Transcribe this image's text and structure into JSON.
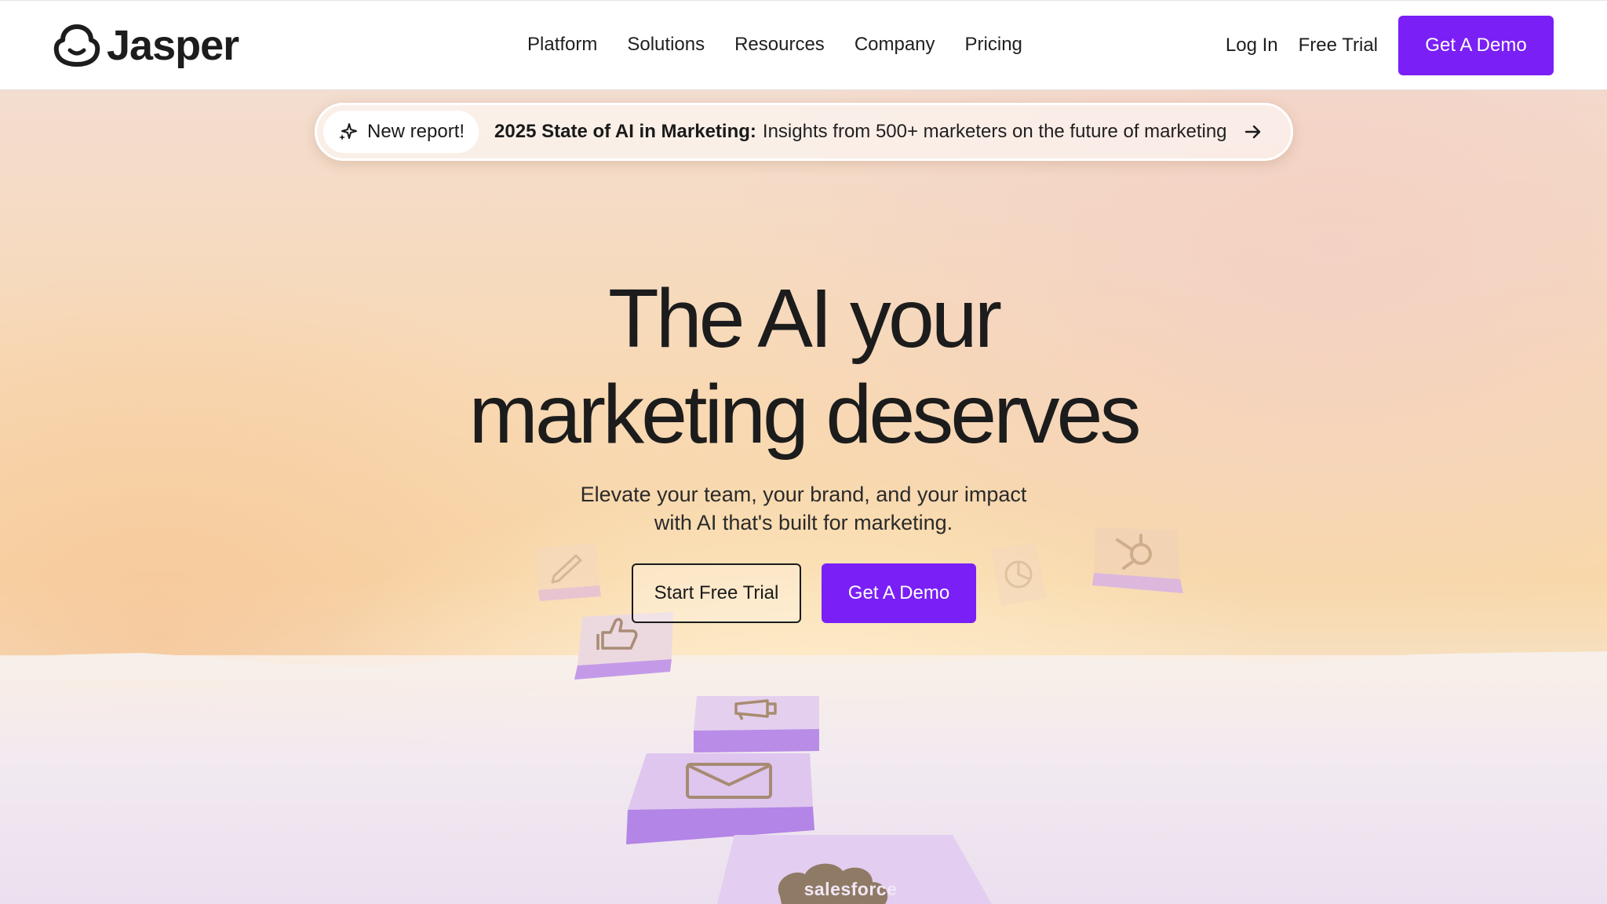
{
  "nav": {
    "brand": "Jasper",
    "links": [
      "Platform",
      "Solutions",
      "Resources",
      "Company",
      "Pricing"
    ],
    "login": "Log In",
    "free_trial": "Free Trial",
    "demo": "Get A Demo"
  },
  "banner": {
    "pill": "New report!",
    "bold": "2025 State of AI in Marketing:",
    "text": "Insights from 500+ marketers on the future of marketing"
  },
  "hero": {
    "headline_line1": "The AI your",
    "headline_line2": "marketing deserves",
    "sub_line1": "Elevate your team, your brand, and your impact",
    "sub_line2": "with AI that's built for marketing.",
    "cta_trial": "Start Free Trial",
    "cta_demo": "Get A Demo"
  },
  "tiles": {
    "salesforce": "salesforce"
  },
  "colors": {
    "accent": "#7a1ff5",
    "text": "#1a1a1a",
    "tile_purple": "#c9a7ef"
  }
}
